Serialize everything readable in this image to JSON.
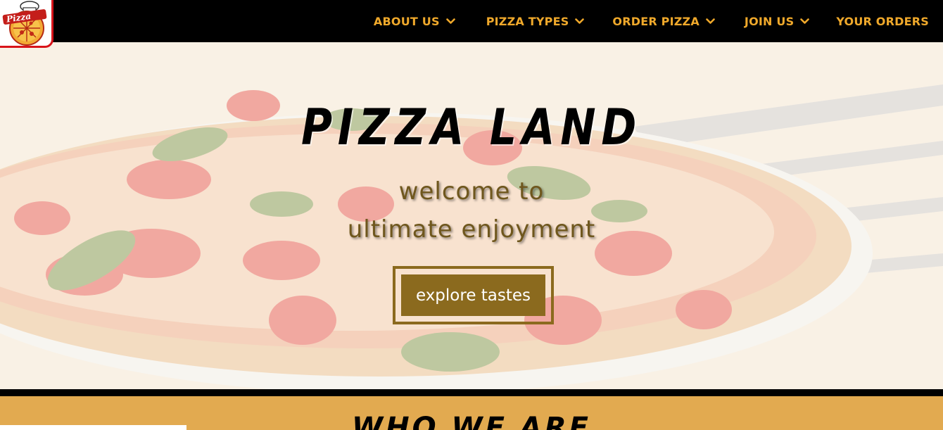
{
  "nav": {
    "logo_text": "Pizza",
    "items": [
      {
        "label": "ABOUT US",
        "dropdown": true
      },
      {
        "label": "PIZZA TYPES",
        "dropdown": true
      },
      {
        "label": "ORDER PIZZA",
        "dropdown": true
      },
      {
        "label": "JOIN US",
        "dropdown": true
      },
      {
        "label": "YOUR ORDERS",
        "dropdown": false
      }
    ]
  },
  "hero": {
    "title": "PIZZA LAND",
    "subtitle_line1": "welcome to",
    "subtitle_line2": "ultimate enjoyment",
    "cta_label": "explore tastes"
  },
  "who": {
    "title": "WHO WE ARE"
  },
  "colors": {
    "nav_bg": "#000000",
    "nav_text": "#f0a92b",
    "cta_bg": "#8b6a1e",
    "section_bg": "#e2aa50",
    "logo_border": "#d8141a"
  },
  "icons": {
    "dropdown": "chevron-down-icon",
    "logo": "pizza-logo-icon"
  }
}
